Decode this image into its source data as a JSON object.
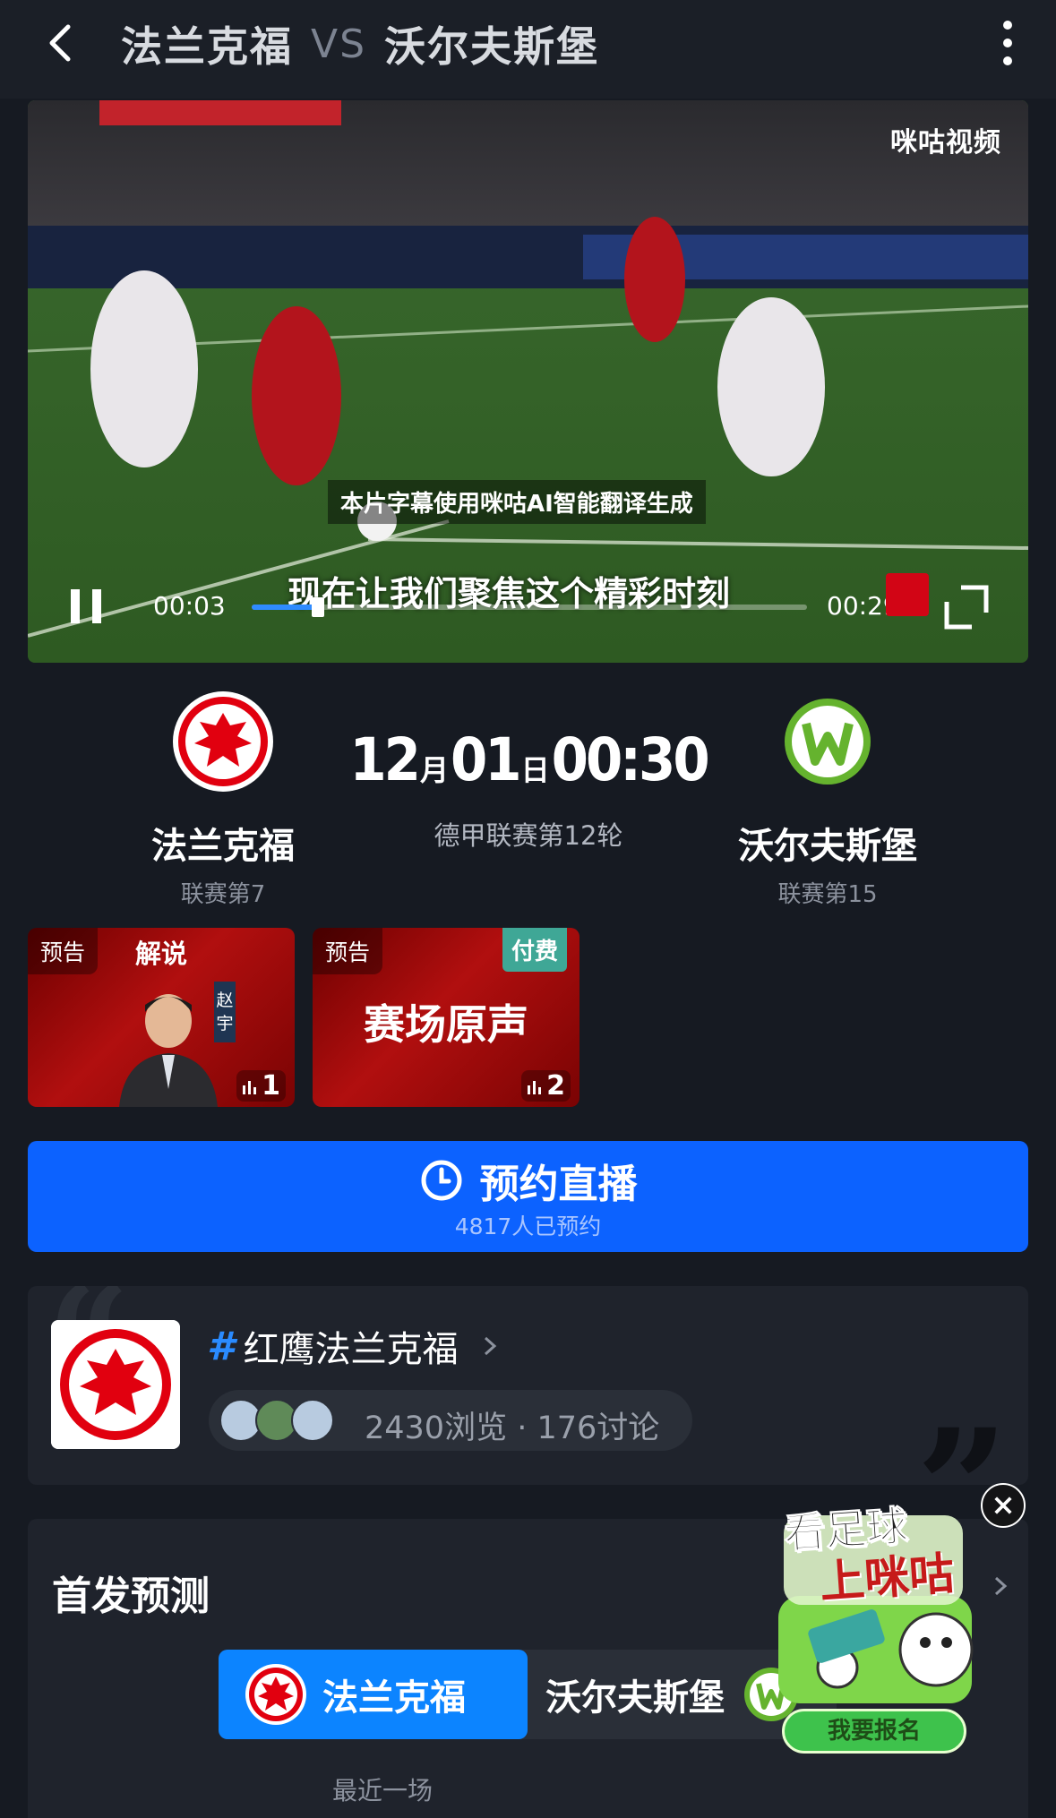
{
  "header": {
    "home_team": "法兰克福",
    "vs": "VS",
    "away_team": "沃尔夫斯堡"
  },
  "video": {
    "brand": "咪咕视频",
    "ai_note": "本片字幕使用咪咕AI智能翻译生成",
    "subtitle": "现在让我们聚焦这个精彩时刻",
    "current_time": "00:03",
    "total_time": "00:29",
    "progress": 0.12
  },
  "match": {
    "home": {
      "name": "法兰克福",
      "rank": "联赛第7"
    },
    "away": {
      "name": "沃尔夫斯堡",
      "rank": "联赛第15"
    },
    "month": "12",
    "month_unit": "月",
    "day": "01",
    "day_unit": "日",
    "time": "00:30",
    "round": "德甲联赛第12轮"
  },
  "audio_cards": [
    {
      "tag": "预告",
      "label": "解说",
      "commentator": "赵宇",
      "count": "1"
    },
    {
      "tag": "预告",
      "pay": "付费",
      "title": "赛场原声",
      "count": "2"
    }
  ],
  "reserve": {
    "label": "预约直播",
    "subtext": "4817人已预约"
  },
  "topic": {
    "hash": "#",
    "title": "红鹰法兰克福",
    "stats": "2430浏览 · 176讨论"
  },
  "lineup": {
    "title": "首发预测",
    "tab_home": "法兰克福",
    "tab_away": "沃尔夫斯堡",
    "recent": "最近一场"
  },
  "ad": {
    "line1": "看足球",
    "line2": "上咪咕",
    "button": "我要报名"
  },
  "colors": {
    "accent_blue": "#0c62ff",
    "tab_blue": "#0c84ff",
    "eintracht_red": "#e1000f",
    "wolfsburg_green": "#65b32e"
  }
}
